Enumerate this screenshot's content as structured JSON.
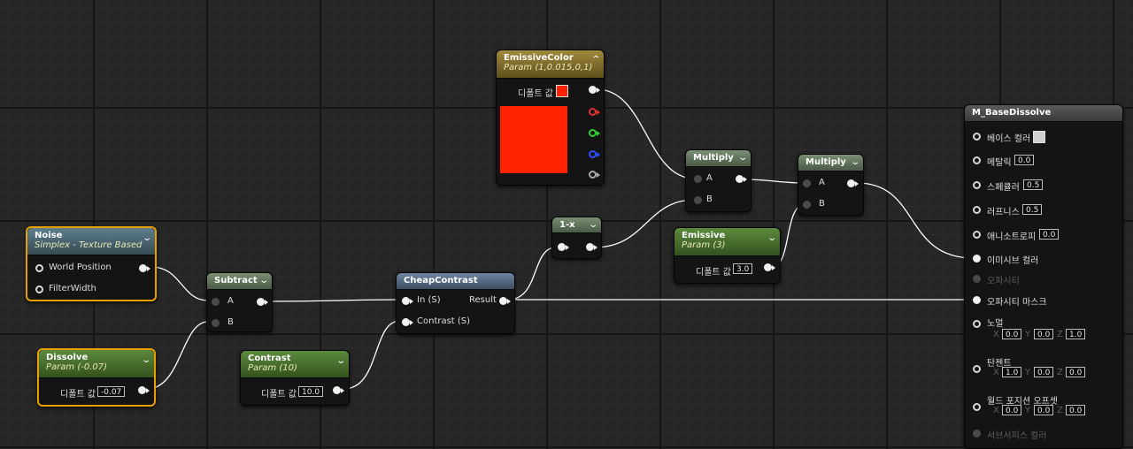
{
  "colors": {
    "emissive_swatch": "#ff2200",
    "base_color_swatch": "#cfcfcf",
    "selection_outline": "#e8a000",
    "wire": "#ffffff"
  },
  "nodes": {
    "emissive_color": {
      "title": "EmissiveColor",
      "subtitle": "Param (1,0.015,0,1)",
      "default_label": "디폴트 값",
      "collapse_icon": "chevron-up-icon"
    },
    "noise": {
      "title": "Noise",
      "subtitle": "Simplex - Texture Based",
      "pin_position": "World Position",
      "pin_filter": "FilterWidth",
      "collapse_icon": "chevron-down-icon"
    },
    "dissolve": {
      "title": "Dissolve",
      "subtitle": "Param (-0.07)",
      "default_label": "디폴트 값",
      "default_value": "-0.07"
    },
    "subtract": {
      "title": "Subtract",
      "pin_a": "A",
      "pin_b": "B"
    },
    "contrast": {
      "title": "Contrast",
      "subtitle": "Param (10)",
      "default_label": "디폴트 값",
      "default_value": "10.0"
    },
    "cheap_contrast": {
      "title": "CheapContrast",
      "pin_in": "In (S)",
      "pin_contrast": "Contrast (S)",
      "pin_result": "Result"
    },
    "one_minus": {
      "title": "1-x"
    },
    "multiply1": {
      "title": "Multiply",
      "pin_a": "A",
      "pin_b": "B"
    },
    "emissive": {
      "title": "Emissive",
      "subtitle": "Param (3)",
      "default_label": "디폴트 값",
      "default_value": "3.0"
    },
    "multiply2": {
      "title": "Multiply",
      "pin_a": "A",
      "pin_b": "B"
    },
    "result": {
      "title": "M_BaseDissolve",
      "base_color": "베이스 컬러",
      "metallic": "메탈릭",
      "metallic_value": "0.0",
      "specular": "스페큘러",
      "specular_value": "0.5",
      "roughness": "러프니스",
      "roughness_value": "0.5",
      "anisotropy": "애니소트로피",
      "anisotropy_value": "0.0",
      "emissive_color": "이미시브 컬러",
      "opacity": "오파시티",
      "opacity_mask": "오파시티 마스크",
      "normal": "노멀",
      "normal_x": "0.0",
      "normal_y": "0.0",
      "normal_z": "1.0",
      "tangent": "탄젠트",
      "tangent_x": "1.0",
      "tangent_y": "0.0",
      "tangent_z": "0.0",
      "wpo": "월드 포지션 오프셋",
      "wpo_x": "0.0",
      "wpo_y": "0.0",
      "wpo_z": "0.0",
      "subsurface": "서브서피스 컬러",
      "x_label": "X",
      "y_label": "Y",
      "z_label": "Z"
    }
  }
}
